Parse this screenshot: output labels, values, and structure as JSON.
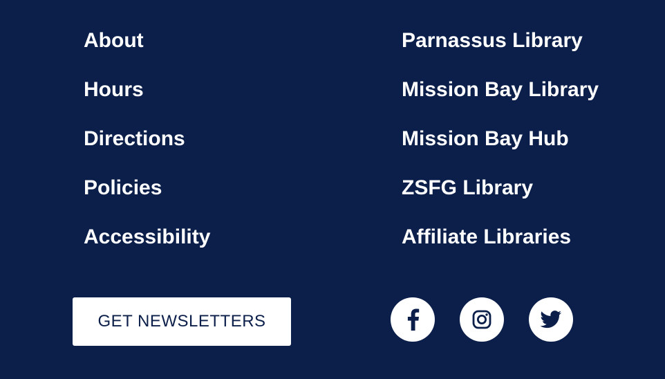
{
  "footer": {
    "left_links": [
      {
        "label": "About"
      },
      {
        "label": "Hours"
      },
      {
        "label": "Directions"
      },
      {
        "label": "Policies"
      },
      {
        "label": "Accessibility"
      }
    ],
    "right_links": [
      {
        "label": "Parnassus Library"
      },
      {
        "label": "Mission Bay Library"
      },
      {
        "label": "Mission Bay Hub"
      },
      {
        "label": "ZSFG Library"
      },
      {
        "label": "Affiliate Libraries"
      }
    ],
    "newsletter_button": "GET NEWSLETTERS",
    "social": [
      {
        "icon": "facebook-icon"
      },
      {
        "icon": "instagram-icon"
      },
      {
        "icon": "twitter-icon"
      }
    ],
    "colors": {
      "background": "#0b1f4a",
      "text": "#ffffff",
      "button_text": "#0b1f4a"
    }
  }
}
